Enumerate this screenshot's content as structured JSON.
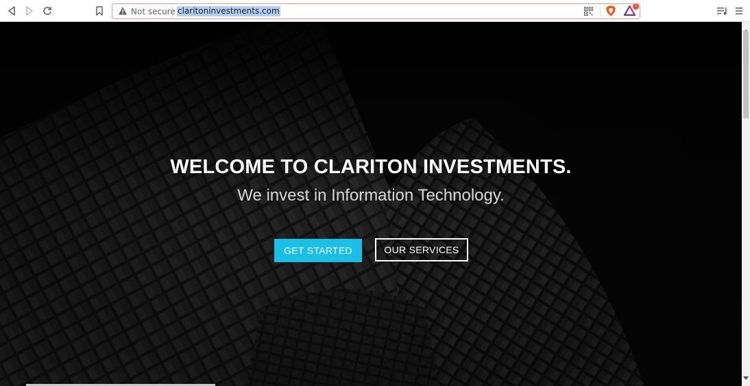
{
  "browser": {
    "security_label": "Not secure",
    "url": "claritoninvestments.com",
    "rewards_badge": "1"
  },
  "hero": {
    "headline": "WELCOME TO CLARITON INVESTMENTS.",
    "subheadline": "We invest in Information Technology.",
    "primary_button": "GET STARTED",
    "secondary_button": "OUR SERVICES"
  },
  "colors": {
    "accent": "#18c0e8",
    "hero_background": "#0b0b0b"
  },
  "icons": {
    "back": "back-arrow-icon",
    "forward": "forward-arrow-icon",
    "reload": "reload-icon",
    "bookmark": "bookmark-icon",
    "warning": "warning-icon",
    "qr": "qr-code-icon",
    "brave": "brave-shields-icon",
    "rewards": "brave-rewards-icon",
    "playlist": "playlist-icon",
    "menu": "menu-icon"
  }
}
